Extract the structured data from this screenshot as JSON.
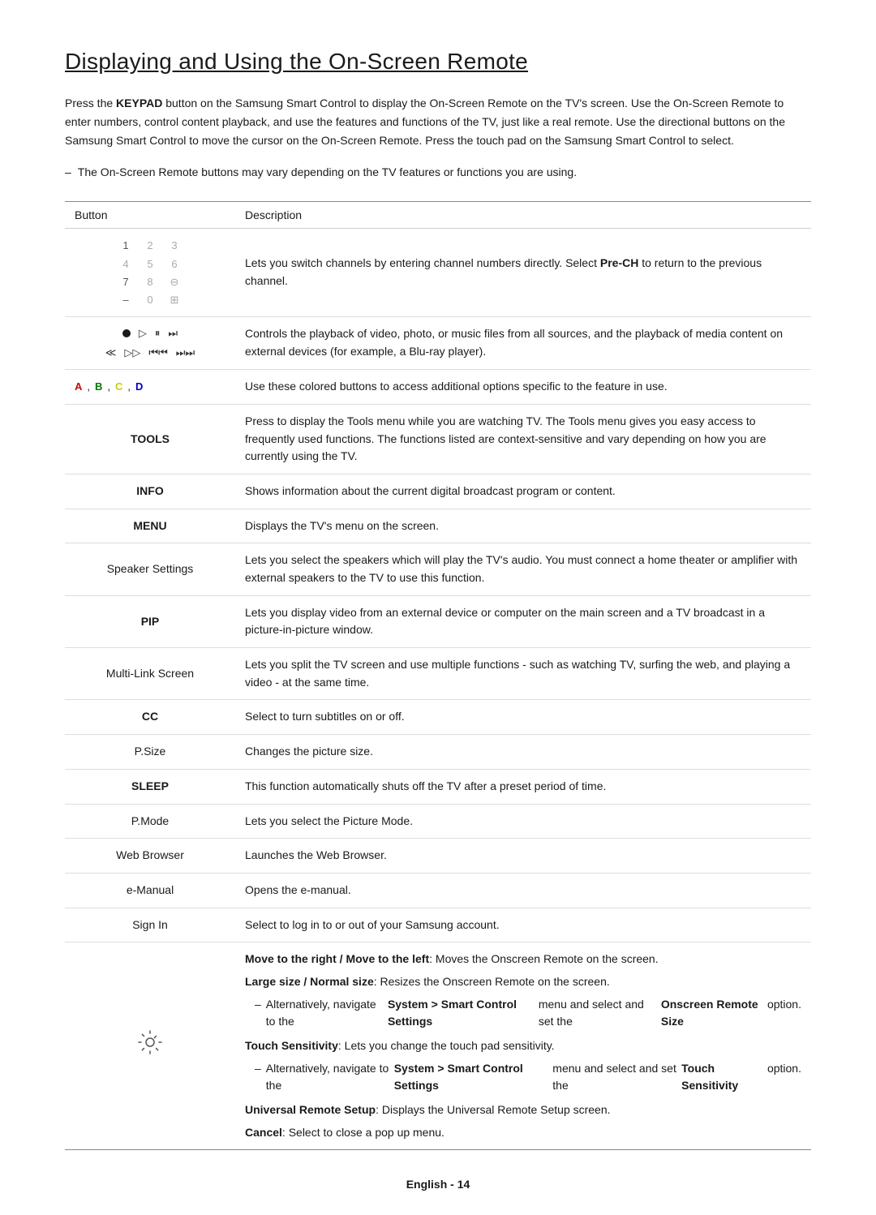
{
  "page": {
    "title": "Displaying and Using the On-Screen Remote",
    "intro": {
      "text": "Press the KEYPAD button on the Samsung Smart Control to display the On-Screen Remote on the TV's screen. Use the On-Screen Remote to enter numbers, control content playback, and use the features and functions of the TV, just like a real remote. Use the directional buttons on the Samsung Smart Control to move the cursor on the On-Screen Remote. Press the touch pad on the Samsung Smart Control to select.",
      "bold_word": "KEYPAD"
    },
    "note": "The On-Screen Remote buttons may vary depending on the TV features or functions you are using.",
    "table": {
      "header": [
        "Button",
        "Description"
      ],
      "rows": [
        {
          "button_label": "numpad",
          "description": "Lets you switch channels by entering channel numbers directly. Select Pre-CH to return to the previous channel.",
          "desc_bold": "Pre-CH"
        },
        {
          "button_label": "media",
          "description": "Controls the playback of video, photo, or music files from all sources, and the playback of media content on external devices (for example, a Blu-ray player)."
        },
        {
          "button_label": "colored",
          "description": "Use these colored buttons to access additional options specific to the feature in use."
        },
        {
          "button_label": "TOOLS",
          "description": "Press to display the Tools menu while you are watching TV. The Tools menu gives you easy access to frequently used functions. The functions listed are context-sensitive and vary depending on how you are currently using the TV."
        },
        {
          "button_label": "INFO",
          "description": "Shows information about the current digital broadcast program or content."
        },
        {
          "button_label": "MENU",
          "description": "Displays the TV's menu on the screen."
        },
        {
          "button_label": "Speaker Settings",
          "description": "Lets you select the speakers which will play the TV's audio. You must connect a home theater or amplifier with external speakers to the TV to use this function."
        },
        {
          "button_label": "PIP",
          "description": "Lets you display video from an external device or computer on the main screen and a TV broadcast in a picture-in-picture window."
        },
        {
          "button_label": "Multi-Link Screen",
          "description": "Lets you split the TV screen and use multiple functions - such as watching TV, surfing the web, and playing a video - at the same time."
        },
        {
          "button_label": "CC",
          "description": "Select to turn subtitles on or off."
        },
        {
          "button_label": "P.Size",
          "description": "Changes the picture size."
        },
        {
          "button_label": "SLEEP",
          "description": "This function automatically shuts off the TV after a preset period of time."
        },
        {
          "button_label": "P.Mode",
          "description": "Lets you select the Picture Mode."
        },
        {
          "button_label": "Web Browser",
          "description": "Launches the Web Browser."
        },
        {
          "button_label": "e-Manual",
          "description": "Opens the e-manual."
        },
        {
          "button_label": "Sign In",
          "description": "Select to log in to or out of your Samsung account."
        },
        {
          "button_label": "gear",
          "description_parts": [
            {
              "type": "bold_lead",
              "bold": "Move to the right / Move to the left",
              "text": ": Moves the Onscreen Remote on the screen."
            },
            {
              "type": "bold_lead",
              "bold": "Large size / Normal size",
              "text": ": Resizes the Onscreen Remote on the screen."
            },
            {
              "type": "sub_note",
              "text": "Alternatively, navigate to the ",
              "bold_text": "System > Smart Control Settings",
              "rest": " menu and select and set the ",
              "bold2": "Onscreen Remote Size",
              "end": " option."
            },
            {
              "type": "bold_lead",
              "bold": "Touch Sensitivity",
              "text": ": Lets you change the touch pad sensitivity."
            },
            {
              "type": "sub_note",
              "text": "Alternatively, navigate to the ",
              "bold_text": "System > Smart Control Settings",
              "rest": " menu and select and set the ",
              "bold2": "Touch Sensitivity",
              "end": " option."
            },
            {
              "type": "bold_lead",
              "bold": "Universal Remote Setup",
              "text": ": Displays the Universal Remote Setup screen."
            },
            {
              "type": "bold_lead",
              "bold": "Cancel",
              "text": ": Select to close a pop up menu."
            }
          ]
        }
      ]
    },
    "footer": "English - 14"
  }
}
